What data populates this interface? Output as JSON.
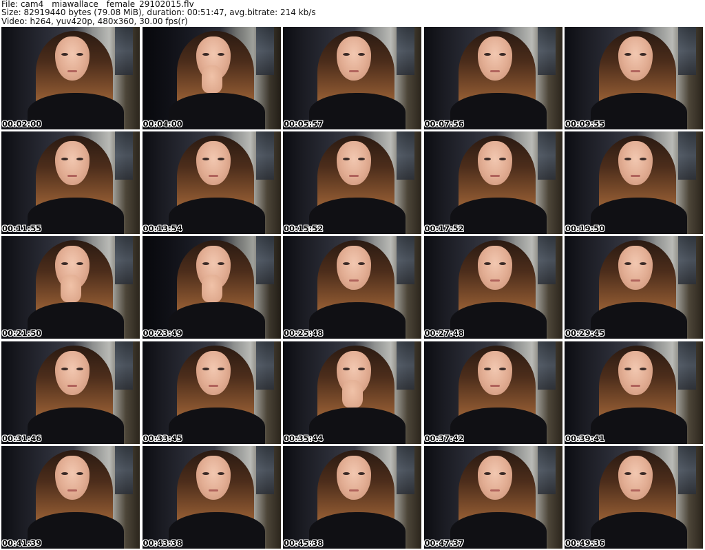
{
  "header": {
    "file_line": "File: cam4__miawallace__female_29102015.flv",
    "size_line": "Size: 82919440 bytes (79.08 MiB), duration: 00:51:47, avg.bitrate: 214 kb/s",
    "video_line": "Video: h264, yuv420p, 480x360, 30.00 fps(r)"
  },
  "thumbnails": [
    {
      "timestamp": "00:02:00"
    },
    {
      "timestamp": "00:04:00"
    },
    {
      "timestamp": "00:05:57"
    },
    {
      "timestamp": "00:07:56"
    },
    {
      "timestamp": "00:09:55"
    },
    {
      "timestamp": "00:11:55"
    },
    {
      "timestamp": "00:13:54"
    },
    {
      "timestamp": "00:15:52"
    },
    {
      "timestamp": "00:17:52"
    },
    {
      "timestamp": "00:19:50"
    },
    {
      "timestamp": "00:21:50"
    },
    {
      "timestamp": "00:23:49"
    },
    {
      "timestamp": "00:25:48"
    },
    {
      "timestamp": "00:27:48"
    },
    {
      "timestamp": "00:29:45"
    },
    {
      "timestamp": "00:31:46"
    },
    {
      "timestamp": "00:33:45"
    },
    {
      "timestamp": "00:35:44"
    },
    {
      "timestamp": "00:37:42"
    },
    {
      "timestamp": "00:39:41"
    },
    {
      "timestamp": "00:41:39"
    },
    {
      "timestamp": "00:43:38"
    },
    {
      "timestamp": "00:45:38"
    },
    {
      "timestamp": "00:47:37"
    },
    {
      "timestamp": "00:49:36"
    }
  ]
}
